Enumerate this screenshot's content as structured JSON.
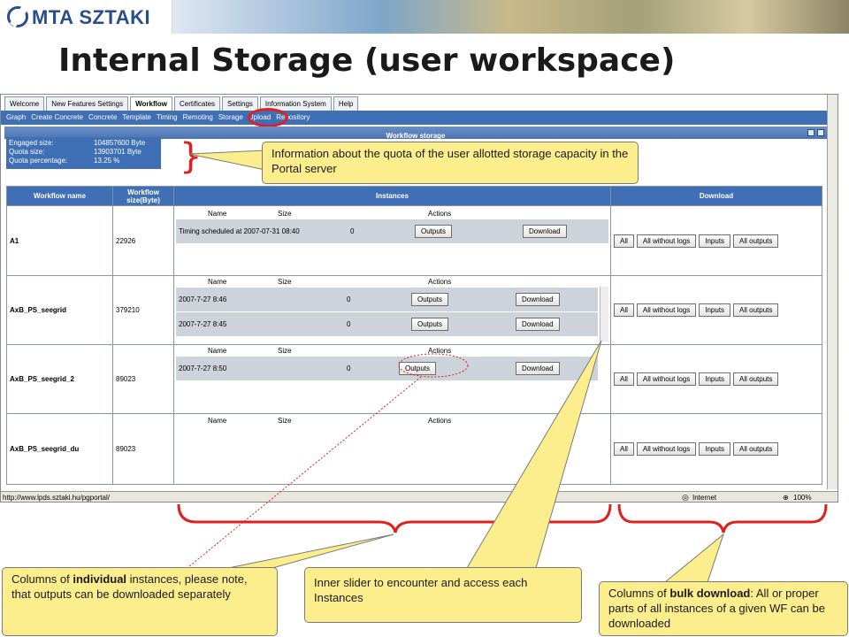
{
  "logo": {
    "text": "MTA SZTAKI"
  },
  "slide_title": "Internal Storage (user workspace)",
  "browser": {
    "tabs": [
      "Welcome",
      "New Features Settings",
      "Workflow",
      "Certificates",
      "Settings",
      "Information System",
      "Help"
    ],
    "active_tab": "Workflow",
    "subnav": [
      "Graph",
      "Create Concrete",
      "Concrete",
      "Template",
      "Timing",
      "Remoting",
      "Storage",
      "Upload",
      "Repository"
    ],
    "active_subnav": "Storage",
    "panel_title": "Workflow storage",
    "quota": {
      "engaged_label": "Engaged size:",
      "engaged_value": "104857600 Byte",
      "quota_label": "Quota size:",
      "quota_value": "13903701 Byte",
      "percent_label": "Quota percentage:",
      "percent_value": "13.25 %"
    },
    "table": {
      "headers": {
        "name": "Workflow name",
        "size": "Workflow size(Byte)",
        "instances": "Instances",
        "download": "Download"
      },
      "inst_headers": {
        "name": "Name",
        "size": "Size",
        "actions": "Actions"
      },
      "buttons": {
        "outputs": "Outputs",
        "download": "Download",
        "all": "All",
        "all_without_logs": "All without logs",
        "inputs": "Inputs",
        "all_outputs": "All outputs"
      },
      "rows": [
        {
          "name": "A1",
          "size": "22926",
          "instances": [
            {
              "name": "Timing scheduled at 2007-07-31 08:40",
              "size": "0"
            }
          ]
        },
        {
          "name": "AxB_PS_seegrid",
          "size": "379210",
          "instances": [
            {
              "name": "2007-7-27 8:46",
              "size": "0"
            },
            {
              "name": "2007-7-27 8:45",
              "size": "0"
            }
          ]
        },
        {
          "name": "AxB_PS_seegrid_2",
          "size": "89023",
          "instances": [
            {
              "name": "2007-7-27 8:50",
              "size": "0"
            }
          ]
        },
        {
          "name": "AxB_PS_seegrid_du",
          "size": "89023",
          "instances": []
        }
      ]
    },
    "status": {
      "url": "http://www.lpds.sztaki.hu/pgportal/",
      "zone": "Internet",
      "zoom": "100%"
    }
  },
  "callouts": {
    "quota": "Information about the  quota of the user allotted storage capacity in the Portal server",
    "individual": {
      "pre": "Columns of ",
      "bold": "individual",
      "post": " instances, please note, that outputs can be downloaded separately"
    },
    "slider": "Inner slider to encounter and access each Instances",
    "bulk": {
      "pre": "Columns of ",
      "bold": "bulk download",
      "post": ": All or proper parts of all instances of a given WF can be downloaded"
    }
  },
  "colors": {
    "accent": "#3f6fb5",
    "callout": "#fcee8c",
    "highlight": "#e0201c"
  }
}
